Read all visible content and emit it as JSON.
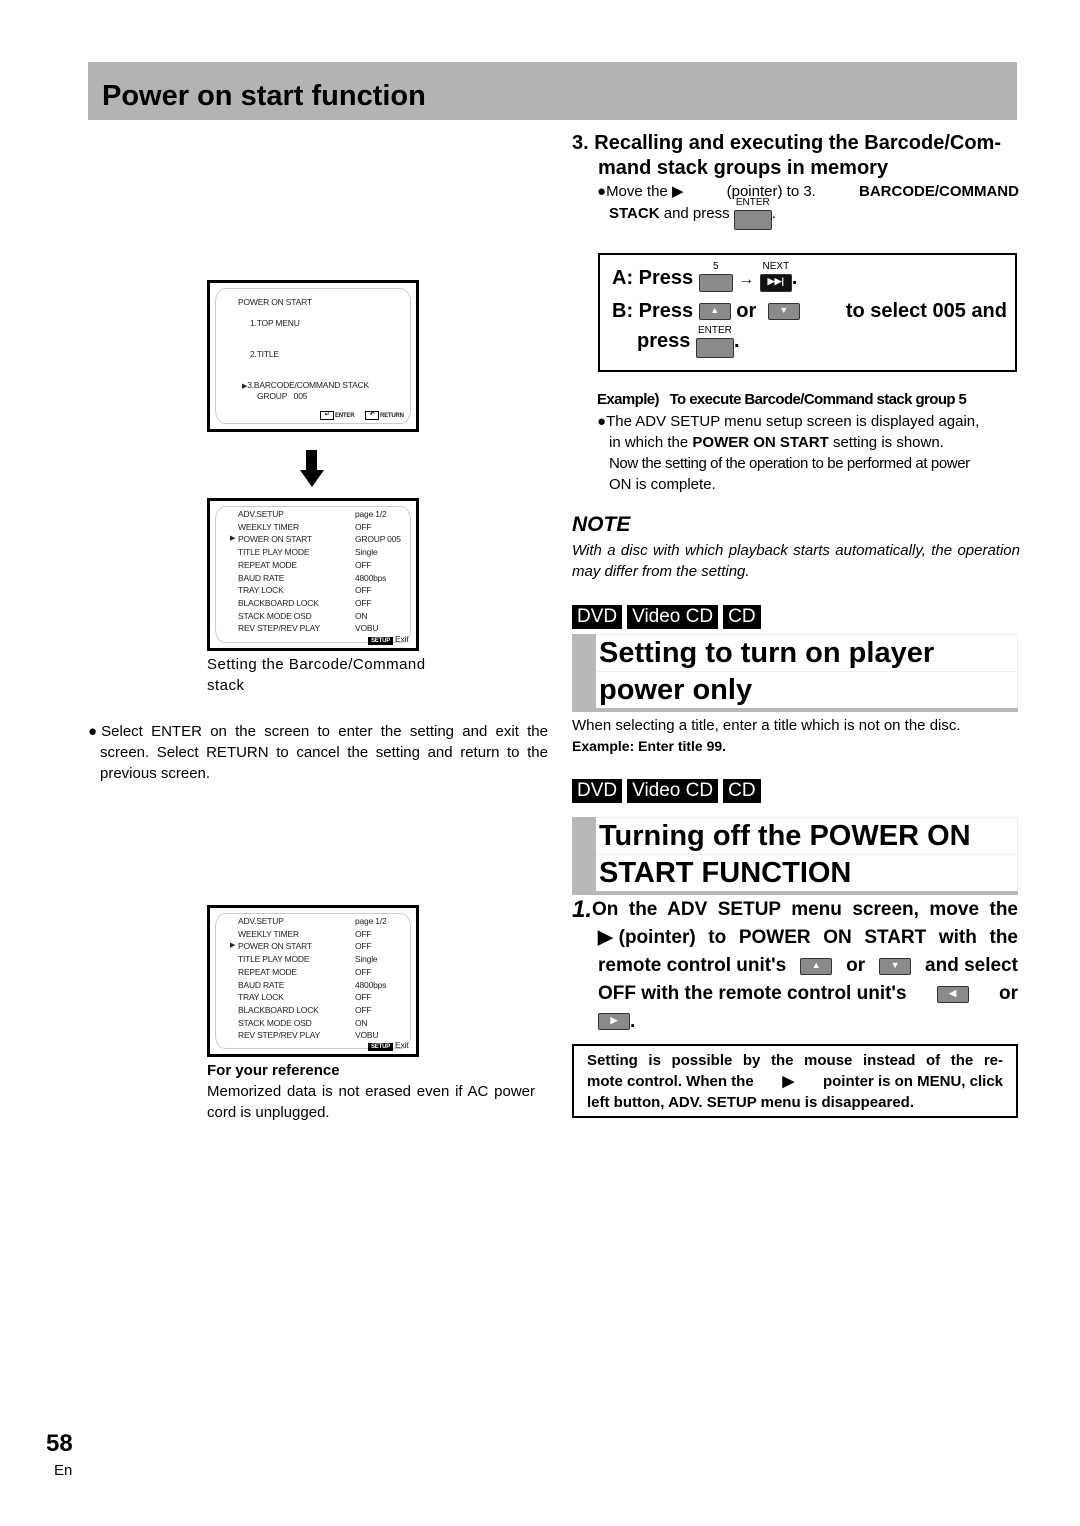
{
  "page_title": "Power on start function",
  "page_number": "58",
  "language": "En",
  "screen1": {
    "title": "POWER ON START",
    "items": [
      "1.TOP MENU",
      "2.TITLE",
      "3.BARCODE/COMMAND STACK"
    ],
    "group_label": "GROUP",
    "group_value": "005",
    "enter_label": "ENTER",
    "return_label": "RETURN",
    "pointer_icon": "triangle-right"
  },
  "arrow_icon": "arrow-down",
  "screen2": {
    "rows": [
      {
        "label": "ADV.SETUP",
        "value": "page 1/2"
      },
      {
        "label": "WEEKLY TIMER",
        "value": "OFF"
      },
      {
        "label": "POWER ON START",
        "value": "GROUP 005",
        "selected": true
      },
      {
        "label": "TITLE PLAY MODE",
        "value": "Single"
      },
      {
        "label": "REPEAT MODE",
        "value": "OFF"
      },
      {
        "label": "BAUD RATE",
        "value": "4800bps"
      },
      {
        "label": "TRAY LOCK",
        "value": "OFF"
      },
      {
        "label": "BLACKBOARD LOCK",
        "value": "OFF"
      },
      {
        "label": "STACK MODE OSD",
        "value": "ON"
      },
      {
        "label": "REV STEP/REV PLAY",
        "value": "VOBU"
      }
    ],
    "setup_key": "SETUP",
    "exit_label": "Exit"
  },
  "screen2_caption": "Setting the Barcode/Command stack",
  "left_bullet": "Select ENTER on the screen to enter the setting and exit the screen. Select RETURN to cancel the setting and return to the previous screen.",
  "screen3": {
    "rows": [
      {
        "label": "ADV.SETUP",
        "value": "page 1/2"
      },
      {
        "label": "WEEKLY TIMER",
        "value": "OFF"
      },
      {
        "label": "POWER ON START",
        "value": "OFF",
        "selected": true
      },
      {
        "label": "TITLE PLAY MODE",
        "value": "Single"
      },
      {
        "label": "REPEAT MODE",
        "value": "OFF"
      },
      {
        "label": "BAUD RATE",
        "value": "4800bps"
      },
      {
        "label": "TRAY LOCK",
        "value": "OFF"
      },
      {
        "label": "BLACKBOARD LOCK",
        "value": "OFF"
      },
      {
        "label": "STACK MODE OSD",
        "value": "ON"
      },
      {
        "label": "REV STEP/REV PLAY",
        "value": "VOBU"
      }
    ],
    "setup_key": "SETUP",
    "exit_label": "Exit"
  },
  "reference": {
    "heading": "For your reference",
    "text": "Memorized data is not erased even if AC power cord is unplugged."
  },
  "step3": {
    "number": "3.",
    "heading_line1": "Recalling and executing the Barcode/Com-",
    "heading_line2": "mand stack groups in memory",
    "bullet_pre": "Move the",
    "bullet_mid": "(pointer) to 3.",
    "bullet_bold1": "BARCODE/COMMAND",
    "bullet_bold2": "STACK",
    "bullet_post": "and press",
    "enter_key": "ENTER"
  },
  "instruction_box": {
    "a_label": "A:",
    "a_press": "Press",
    "a_key1": "5",
    "a_key2": "NEXT",
    "b_label": "B:",
    "b_press": "Press",
    "b_or": "or",
    "b_rest": "to select 005 and",
    "b_press2": "press",
    "b_enter": "ENTER"
  },
  "example": {
    "label": "Example)",
    "text": "To execute Barcode/Command stack group 5",
    "bullet_line1": "The ADV SETUP menu setup screen is displayed again,",
    "bullet_line2_pre": "in which the",
    "bullet_line2_bold": "POWER ON START",
    "bullet_line2_post": "setting is shown.",
    "bullet_line3": "Now the setting of the operation to be performed at power",
    "bullet_line4": "ON is complete."
  },
  "note": {
    "heading": "NOTE",
    "text": "With a disc with which playback starts automatically, the operation may differ from the setting."
  },
  "badges": [
    "DVD",
    "Video CD",
    "CD"
  ],
  "section1": {
    "title_line1": "Setting to turn on player",
    "title_line2": "power only",
    "text": "When selecting a title, enter a title which is not on the disc.",
    "example": "Example: Enter title 99."
  },
  "section2": {
    "title_line1": "Turning off the POWER ON",
    "title_line2": "START FUNCTION",
    "step_number": "1.",
    "step_line1": "On the ADV SETUP menu screen, move the",
    "step_line2": "(pointer) to POWER ON START with the",
    "step_line3_pre": "remote control unit's",
    "step_or": "or",
    "step_line3_post": "and select",
    "step_line4": "OFF with the remote control unit's",
    "step_or2": "or"
  },
  "mouse_box": {
    "line1": "Setting is possible by the mouse instead of the re-",
    "line2_pre": "mote control. When the",
    "line2_post": "pointer is on MENU, click",
    "line3": "left button, ADV. SETUP menu is disappeared."
  }
}
